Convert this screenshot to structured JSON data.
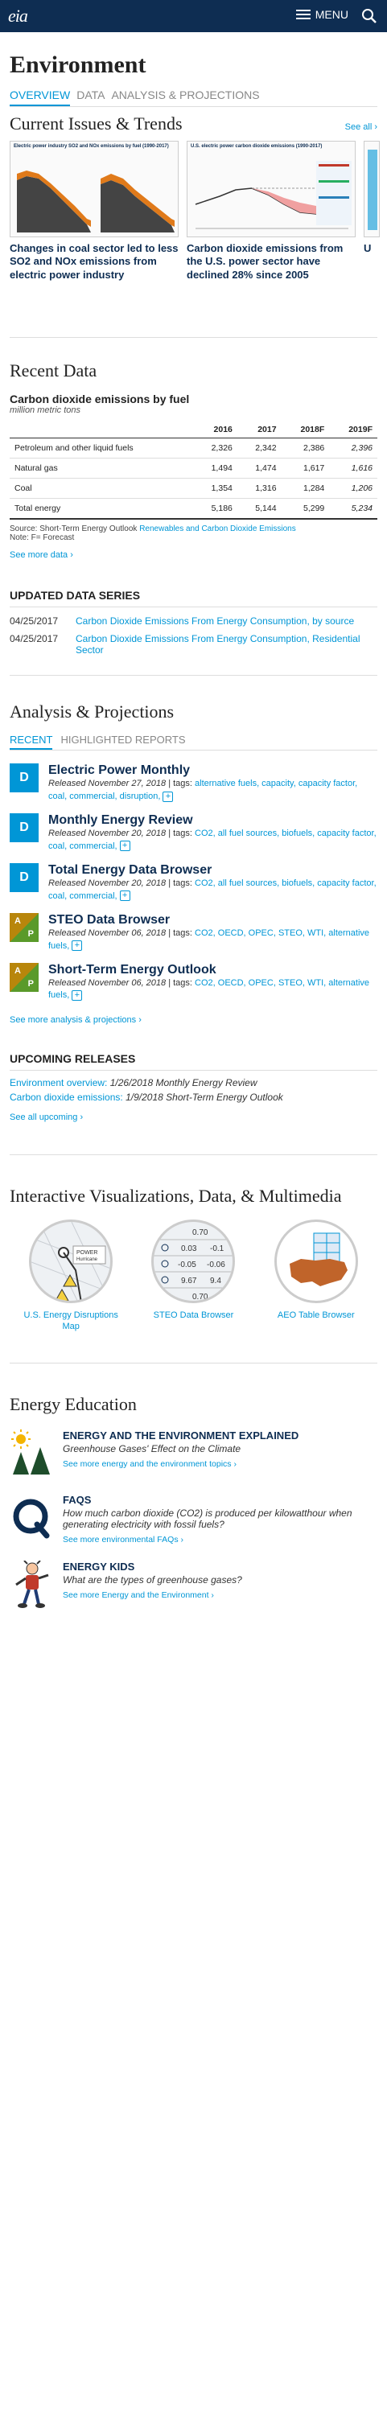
{
  "header": {
    "logo": "eia",
    "menu_label": "MENU"
  },
  "page": {
    "title": "Environment"
  },
  "tabs": [
    {
      "label": "OVERVIEW"
    },
    {
      "label": "DATA"
    },
    {
      "label": "ANALYSIS & PROJECTIONS"
    }
  ],
  "current_issues": {
    "title": "Current Issues & Trends",
    "see_all": "See all ›",
    "cards": [
      {
        "title": "Changes in coal sector led to less SO2 and NOx emissions from electric power industry",
        "chart_title": "Electric power industry SO2 and NOx emissions by fuel (1990-2017)"
      },
      {
        "title": "Carbon dioxide emissions from the U.S. power sector have declined 28% since 2005",
        "chart_title": "U.S. electric power carbon dioxide emissions (1990-2017)"
      },
      {
        "title": "U"
      }
    ]
  },
  "recent_data": {
    "title": "Recent Data",
    "table_title": "Carbon dioxide emissions by fuel",
    "units": "million metric tons",
    "columns": [
      "",
      "2016",
      "2017",
      "2018F",
      "2019F"
    ],
    "rows": [
      [
        "Petroleum and other liquid fuels",
        "2,326",
        "2,342",
        "2,386",
        "2,396"
      ],
      [
        "Natural gas",
        "1,494",
        "1,474",
        "1,617",
        "1,616"
      ],
      [
        "Coal",
        "1,354",
        "1,316",
        "1,284",
        "1,206"
      ],
      [
        "Total energy",
        "5,186",
        "5,144",
        "5,299",
        "5,234"
      ]
    ],
    "source_prefix": "Source: Short-Term Energy Outlook",
    "source_link": "Renewables and Carbon Dioxide Emissions",
    "note": "Note: F= Forecast",
    "more_link": "See more data ›"
  },
  "updated_series": {
    "title": "UPDATED DATA SERIES",
    "items": [
      {
        "date": "04/25/2017",
        "label": "Carbon Dioxide Emissions From Energy Consumption, by source"
      },
      {
        "date": "04/25/2017",
        "label": "Carbon Dioxide Emissions From Energy Consumption, Residential Sector"
      }
    ]
  },
  "analysis": {
    "title": "Analysis & Projections",
    "tabs": [
      "RECENT",
      "HIGHLIGHTED REPORTS"
    ],
    "items": [
      {
        "badge": "D",
        "title": "Electric Power Monthly",
        "released": "Released November 27, 2018",
        "tags_label": " | tags: ",
        "tags": "alternative fuels, capacity, capacity factor, coal, commercial, disruption,"
      },
      {
        "badge": "D",
        "title": "Monthly Energy Review",
        "released": "Released November 20, 2018",
        "tags_label": " | tags: ",
        "tags": "CO2, all fuel sources, biofuels, capacity factor, coal, commercial,"
      },
      {
        "badge": "D",
        "title": "Total Energy Data Browser",
        "released": "Released November 20, 2018",
        "tags_label": " | tags: ",
        "tags": "CO2, all fuel sources, biofuels, capacity factor, coal, commercial,"
      },
      {
        "badge": "A P",
        "title": "STEO Data Browser",
        "released": "Released November 06, 2018",
        "tags_label": " | tags: ",
        "tags": "CO2, OECD, OPEC, STEO, WTI, alternative fuels,"
      },
      {
        "badge": "A P",
        "title": "Short-Term Energy Outlook",
        "released": "Released November 06, 2018",
        "tags_label": " | tags: ",
        "tags": "CO2, OECD, OPEC, STEO, WTI, alternative fuels,"
      }
    ],
    "more_link": "See more analysis & projections ›"
  },
  "upcoming": {
    "title": "UPCOMING RELEASES",
    "items": [
      {
        "label": "Environment overview:",
        "detail": "1/26/2018 Monthly Energy Review"
      },
      {
        "label": "Carbon dioxide emissions:",
        "detail": "1/9/2018 Short-Term Energy Outlook"
      }
    ],
    "more_link": "See all upcoming ›"
  },
  "viz": {
    "title": "Interactive Visualizations, Data, & Multimedia",
    "items": [
      {
        "label": "U.S. Energy Disruptions Map",
        "map_text": "POWER",
        "map_sub": "Hurricane"
      },
      {
        "label": "STEO Data Browser",
        "vals": [
          "0.70",
          "0.03",
          "-0.1",
          "-0.05",
          "-0.06",
          "9.67",
          "9.4",
          "0.70"
        ]
      },
      {
        "label": "AEO Table Browser"
      }
    ]
  },
  "education": {
    "title": "Energy Education",
    "items": [
      {
        "title": "ENERGY AND THE ENVIRONMENT EXPLAINED",
        "sub": "Greenhouse Gases' Effect on the Climate",
        "link": "See more energy and the environment topics ›"
      },
      {
        "title": "FAQS",
        "sub": "How much carbon dioxide (CO2) is produced per kilowatthour when generating electricity with fossil fuels?",
        "link": "See more environmental FAQs ›"
      },
      {
        "title": "ENERGY KIDS",
        "sub": "What are the types of greenhouse gases?",
        "link": "See more Energy and the Environment ›"
      }
    ]
  }
}
